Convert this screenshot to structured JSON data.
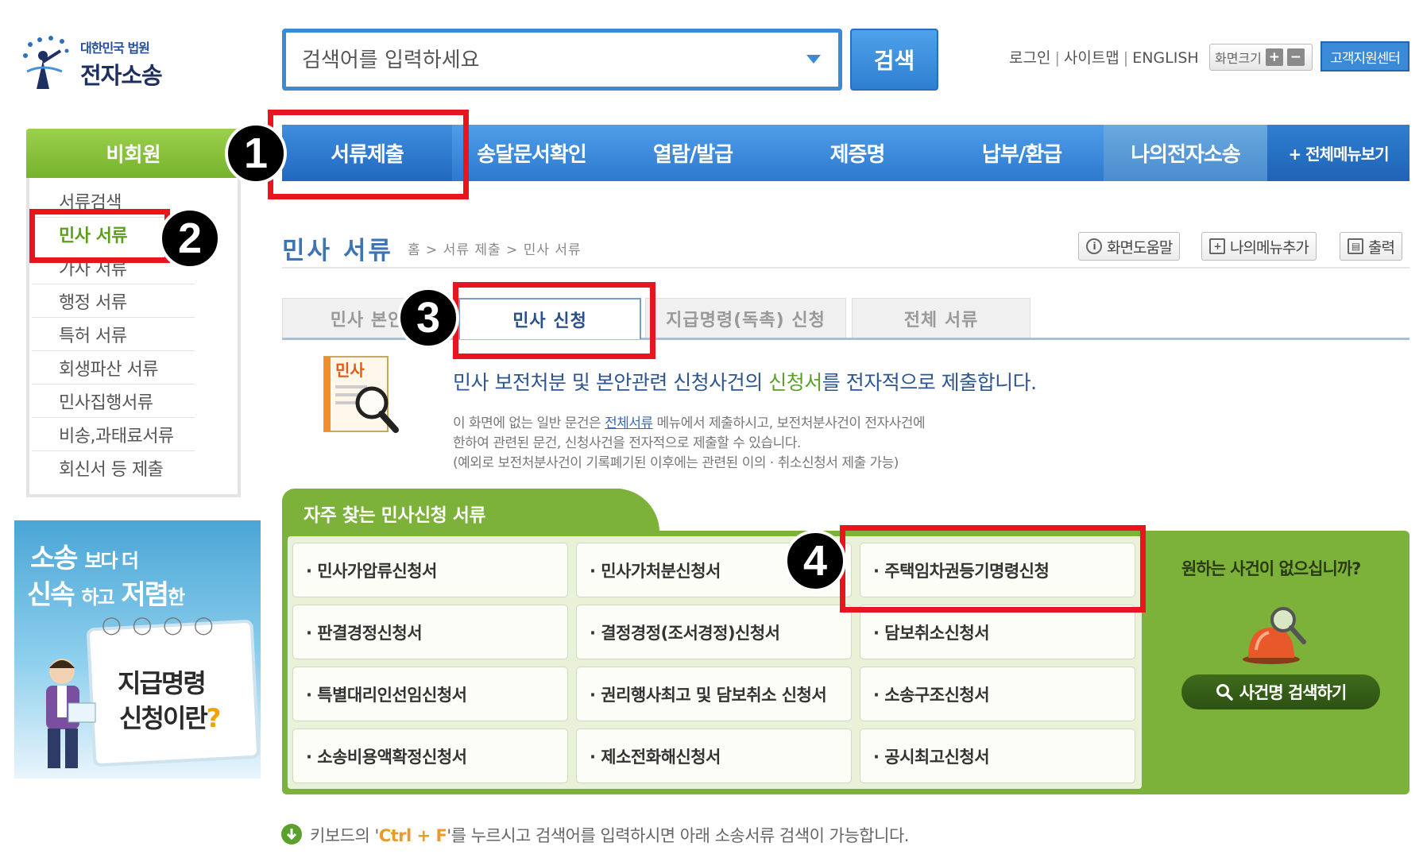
{
  "header": {
    "logo_sub": "대한민국 법원",
    "logo_main": "전자소송",
    "search_placeholder": "검색어를 입력하세요",
    "search_button": "검색",
    "links": [
      "로그인",
      "사이트맵",
      "ENGLISH"
    ],
    "font_size_label": "화면크기",
    "font_plus": "+",
    "font_minus": "−",
    "customer_center": "고객지원센터"
  },
  "nav": {
    "items": [
      {
        "label": "서류제출"
      },
      {
        "label": "송달문서확인"
      },
      {
        "label": "열람/발급"
      },
      {
        "label": "제증명"
      },
      {
        "label": "납부/환급"
      },
      {
        "label": "나의전자소송"
      },
      {
        "label": "+ 전체메뉴보기"
      }
    ]
  },
  "sidebar": {
    "heading": "비회원",
    "items": [
      {
        "label": "서류검색"
      },
      {
        "label": "민사 서류"
      },
      {
        "label": "가사 서류"
      },
      {
        "label": "행정 서류"
      },
      {
        "label": "특허 서류"
      },
      {
        "label": "회생파산 서류"
      },
      {
        "label": "민사집행서류"
      },
      {
        "label": "비송,과태료서류"
      },
      {
        "label": "회신서 등 제출"
      }
    ]
  },
  "banner": {
    "line1_big": "소송",
    "line1_small": "보다 더",
    "line2_big_a": "신속",
    "line2_small_a": "하고",
    "line2_big_b": "저렴",
    "line2_small_b": "한",
    "card_line1": "지급명령",
    "card_line2": "신청이란",
    "card_q": "?"
  },
  "page": {
    "title": "민사 서류",
    "breadcrumb": "홈 > 서류 제출 > 민사 서류",
    "help": "화면도움말",
    "add_menu": "나의메뉴추가",
    "print": "출력"
  },
  "tabs": [
    {
      "label": "민사 본안"
    },
    {
      "label": "민사 신청"
    },
    {
      "label": "지급명령(독촉) 신청"
    },
    {
      "label": "전체 서류"
    }
  ],
  "intro": {
    "icon_label": "민사",
    "head_a": "민사 보전처분 및 본안관련 신청사건의 ",
    "head_hl": "신청서",
    "head_b": "를 전자적으로 제출합니다.",
    "p1_a": "이 화면에 없는 일반 문건은 ",
    "p1_link": "전체서류",
    "p1_b": " 메뉴에서 제출하시고, 보전처분사건이 전자사건에",
    "p2": "한하여 관련된 문건, 신청사건을 전자적으로 제출할 수 있습니다.",
    "p3": "(예외로 보전처분사건이 기록폐기된 이후에는 관련된 이의 · 취소신청서 제출 가능)"
  },
  "frequent": {
    "title": "자주 찾는 민사신청 서류",
    "items": [
      "· 민사가압류신청서",
      "· 민사가처분신청서",
      "· 주택임차권등기명령신청",
      "· 판결경정신청서",
      "· 결정경정(조서경정)신청서",
      "· 담보취소신청서",
      "· 특별대리인선임신청서",
      "· 권리행사최고 및 담보취소 신청서",
      "· 소송구조신청서",
      "· 소송비용액확정신청서",
      "· 제소전화해신청서",
      "· 공시최고신청서"
    ],
    "side_question": "원하는 사건이 없으십니까?",
    "side_button": "사건명 검색하기"
  },
  "hint": {
    "a": "키보드의 '",
    "key": "Ctrl + F",
    "b": "'를 누르시고 검색어를 입력하시면 아래 소송서류 검색이 가능합니다."
  },
  "annotations": [
    "1",
    "2",
    "3",
    "4"
  ],
  "colors": {
    "nav_blue": "#2d79cf",
    "side_green": "#77b32c",
    "panel_green": "#7cb13a",
    "highlight_red": "#e8141e"
  }
}
